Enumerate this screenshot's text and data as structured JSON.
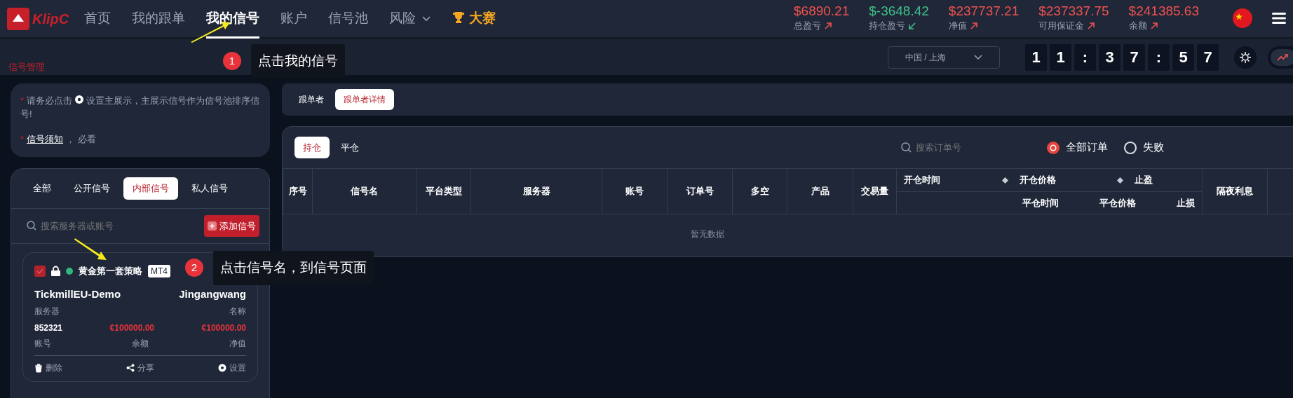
{
  "nav": {
    "brand": "KlipC",
    "items": [
      {
        "label": "首页",
        "selected": false,
        "kind": "link"
      },
      {
        "label": "我的跟单",
        "selected": false,
        "kind": "link"
      },
      {
        "label": "我的信号",
        "selected": true,
        "kind": "link"
      },
      {
        "label": "账户",
        "selected": false,
        "kind": "link"
      },
      {
        "label": "信号池",
        "selected": false,
        "kind": "link"
      },
      {
        "label": "风险",
        "selected": false,
        "kind": "dropdown"
      },
      {
        "label": "大赛",
        "selected": false,
        "kind": "contest"
      }
    ]
  },
  "stats": [
    {
      "value": "$6890.21",
      "label": "总盈亏",
      "rising": true
    },
    {
      "value": "$-3648.42",
      "label": "持仓盈亏",
      "rising": false
    },
    {
      "value": "$237737.21",
      "label": "净值",
      "rising": true
    },
    {
      "value": "$237337.75",
      "label": "可用保证金",
      "rising": true
    },
    {
      "value": "$241385.63",
      "label": "余额",
      "rising": true
    }
  ],
  "breadcrumb": "信号管理",
  "timezone": "中国 / 上海",
  "clock": [
    "1",
    "1",
    ":",
    "3",
    "7",
    ":",
    "5",
    "7"
  ],
  "notice": {
    "marker": "*",
    "text_before": "请务必点击",
    "text_after": "设置主展示，主展示信号作为信号池排序信号!",
    "link": "信号须知",
    "suffix": "， 必看"
  },
  "signal_tabs": [
    {
      "label": "全部",
      "selected": false
    },
    {
      "label": "公开信号",
      "selected": false
    },
    {
      "label": "内部信号",
      "selected": true
    },
    {
      "label": "私人信号",
      "selected": false
    }
  ],
  "signal_search": {
    "placeholder": "搜索服务器或账号"
  },
  "add_button": "添加信号",
  "signal_card": {
    "checked": true,
    "online": true,
    "name": "黄金第一套策略",
    "platform": "MT4",
    "fields": [
      {
        "value": "TickmillEU-Demo",
        "label": "服务器"
      },
      {
        "value": "Jingangwang",
        "label": "名称"
      },
      {
        "value": "852321",
        "label": "账号"
      },
      {
        "value": "€100000.00",
        "label": "余额"
      },
      {
        "value": "€100000.00",
        "label": "净值"
      }
    ],
    "actions": [
      {
        "label": "删除",
        "kind": "delete"
      },
      {
        "label": "分享",
        "kind": "share"
      },
      {
        "label": "设置",
        "kind": "settings"
      }
    ]
  },
  "view_tabs": [
    {
      "label": "跟单者",
      "selected": false
    },
    {
      "label": "跟单者详情",
      "selected": true
    }
  ],
  "order_tabs": [
    {
      "label": "持仓",
      "selected": true
    },
    {
      "label": "平仓",
      "selected": false
    }
  ],
  "order_search": {
    "placeholder": "搜索订单号"
  },
  "order_filters": [
    {
      "label": "全部订单",
      "selected": true
    },
    {
      "label": "失败",
      "selected": false
    }
  ],
  "table": {
    "columns": [
      "序号",
      "信号名",
      "平台类型",
      "服务器",
      "账号",
      "订单号",
      "多空",
      "产品",
      "交易量"
    ],
    "group_top": [
      "开仓时间",
      "开仓价格",
      "止盈"
    ],
    "group_bottom": [
      "平仓时间",
      "平仓价格",
      "止损"
    ],
    "columns_after": [
      "隔夜利息"
    ],
    "empty_text": "暂无数据"
  },
  "callouts": [
    {
      "number": "1",
      "text": "点击我的信号"
    },
    {
      "number": "2",
      "text": "点击信号名，到信号页面"
    }
  ]
}
